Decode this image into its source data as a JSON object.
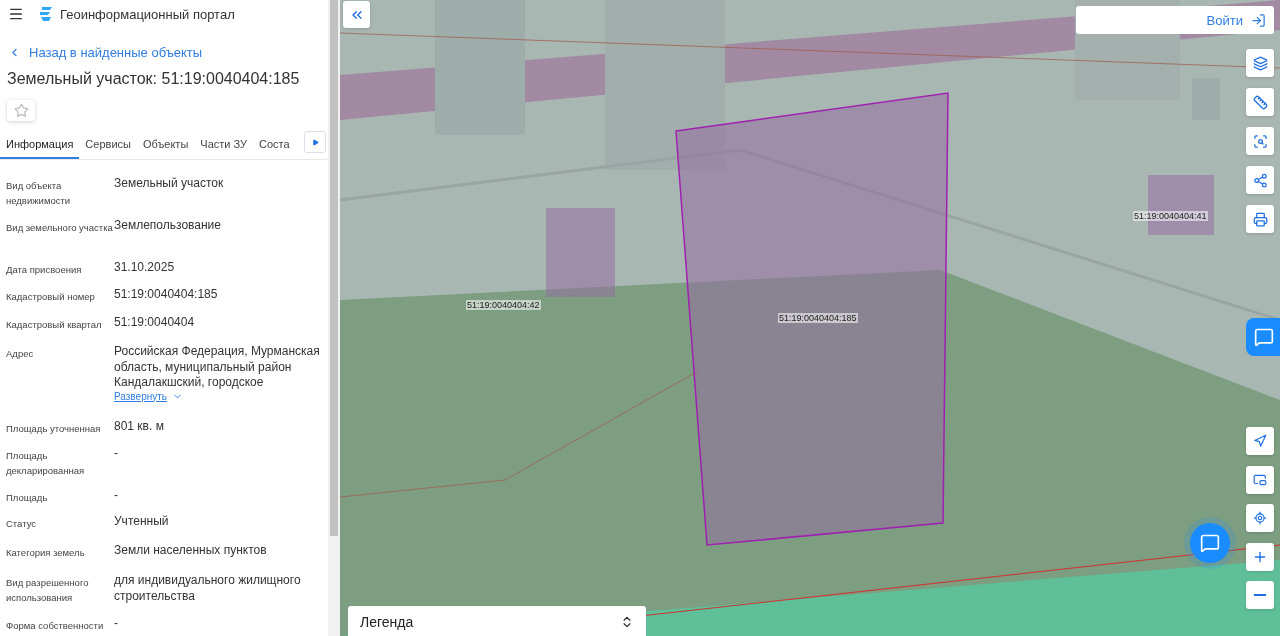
{
  "header": {
    "title": "Геоинформационный портал"
  },
  "back_link": "Назад в найденные объекты",
  "heading": "Земельный участок: 51:19:0040404:185",
  "favorite": {
    "on": false
  },
  "tabs": [
    {
      "label": "Информация",
      "selected": true
    },
    {
      "label": "Сервисы",
      "selected": false
    },
    {
      "label": "Объекты",
      "selected": false
    },
    {
      "label": "Части ЗУ",
      "selected": false
    },
    {
      "label": "Соста",
      "selected": false
    }
  ],
  "fields": [
    {
      "label": "Вид объекта недвижимости",
      "value": "Земельный участок"
    },
    {
      "label": "Вид земельного участка",
      "value": "Землепользование"
    },
    {
      "label": "Дата присвоения",
      "value": "31.10.2025"
    },
    {
      "label": "Кадастровый номер",
      "value": "51:19:0040404:185"
    },
    {
      "label": "Кадастровый квартал",
      "value": "51:19:0040404"
    },
    {
      "label": "Адрес",
      "value": "Российская Федерация, Мурманская область, муниципальный район Кандалакшский, городское",
      "expand_link": "Развернуть"
    },
    {
      "label": "Площадь уточненная",
      "value": "801 кв. м"
    },
    {
      "label": "Площадь декларированная",
      "value": "-"
    },
    {
      "label": "Площадь",
      "value": "-"
    },
    {
      "label": "Статус",
      "value": "Учтенный"
    },
    {
      "label": "Категория земель",
      "value": "Земли населенных пунктов"
    },
    {
      "label": "Вид разрешенного использования",
      "value": "для индивидуального жилищного строительства"
    },
    {
      "label": "Форма собственности",
      "value": "-"
    }
  ],
  "map": {
    "login_button": "Войти",
    "legend": "Легенда",
    "parcels": [
      {
        "label": "51:19:0040404:185",
        "selected": true
      },
      {
        "label": "51:19:0040404:42",
        "selected": false
      },
      {
        "label": "51:19:0040404:41",
        "selected": false
      }
    ]
  }
}
